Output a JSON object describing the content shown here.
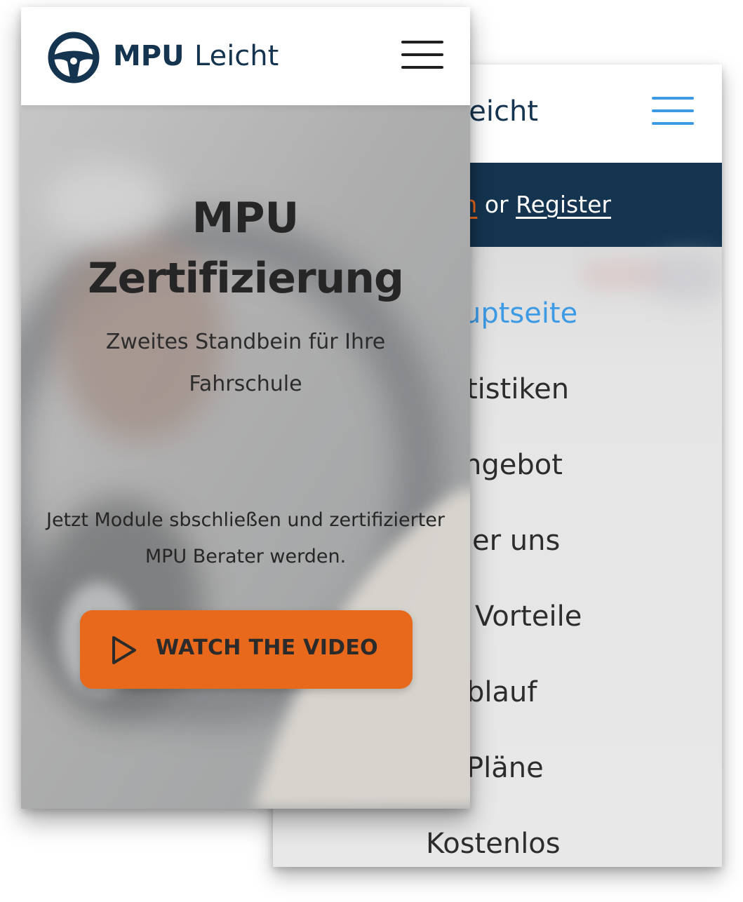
{
  "back_screen": {
    "brand_partial": "eicht",
    "auth": {
      "login_partial": "in",
      "separator": "or",
      "register": "Register"
    },
    "menu": [
      {
        "label": "uptseite",
        "active": true
      },
      {
        "label": "tistiken",
        "active": false
      },
      {
        "label": "ngebot",
        "active": false
      },
      {
        "label": "er uns",
        "active": false
      },
      {
        "label": "Vorteile",
        "active": false
      },
      {
        "label": "blauf",
        "active": false
      },
      {
        "label": "Pläne",
        "active": false
      },
      {
        "label": "Kostenlos",
        "active": false
      }
    ]
  },
  "front_screen": {
    "brand": {
      "bold": "MPU",
      "light": "Leicht"
    },
    "hero": {
      "title_line1": "MPU",
      "title_line2": "Zertifizierung",
      "subtitle": "Zweites Standbein für Ihre Fahrschule",
      "body": "Jetzt Module sbschließen und zertifizierter MPU Berater werden.",
      "cta_label": "WATCH THE VIDEO"
    }
  },
  "colors": {
    "brand_navy": "#14344f",
    "accent_orange": "#e8691b",
    "accent_blue": "#3d9be6"
  },
  "icons": [
    "steering-wheel-icon",
    "hamburger-menu-icon",
    "play-icon"
  ]
}
